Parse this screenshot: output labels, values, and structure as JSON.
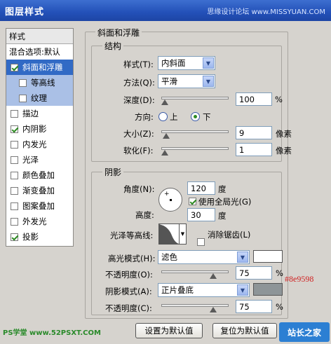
{
  "window": {
    "title": "图层样式",
    "watermark": "思缘设计论坛 www.MISSYUAN.COM"
  },
  "sidebar": {
    "head": "样式",
    "items": [
      {
        "label": "混合选项:默认"
      },
      {
        "label": "斜面和浮雕",
        "checked": true,
        "selected": true
      },
      {
        "label": "等高线",
        "checked": false
      },
      {
        "label": "纹理",
        "checked": false
      },
      {
        "label": "描边",
        "checked": false
      },
      {
        "label": "内阴影",
        "checked": true
      },
      {
        "label": "内发光",
        "checked": false
      },
      {
        "label": "光泽",
        "checked": false
      },
      {
        "label": "颜色叠加",
        "checked": false
      },
      {
        "label": "渐变叠加",
        "checked": false
      },
      {
        "label": "图案叠加",
        "checked": false
      },
      {
        "label": "外发光",
        "checked": false
      },
      {
        "label": "投影",
        "checked": true
      }
    ]
  },
  "bevel": {
    "title": "斜面和浮雕",
    "structure": {
      "title": "结构",
      "style_label": "样式(T):",
      "style_value": "内斜面",
      "technique_label": "方法(Q):",
      "technique_value": "平滑",
      "depth_label": "深度(D):",
      "depth_value": "100",
      "depth_unit": "%",
      "direction_label": "方向:",
      "direction_up": "上",
      "direction_down": "下",
      "size_label": "大小(Z):",
      "size_value": "9",
      "size_unit": "像素",
      "soften_label": "软化(F):",
      "soften_value": "1",
      "soften_unit": "像素"
    },
    "shading": {
      "title": "阴影",
      "angle_label": "角度(N):",
      "angle_value": "120",
      "angle_unit": "度",
      "global_light_label": "使用全局光(G)",
      "altitude_label": "高度:",
      "altitude_value": "30",
      "altitude_unit": "度",
      "gloss_label": "光泽等高线:",
      "antialias_label": "消除锯齿(L)",
      "highlight_mode_label": "高光模式(H):",
      "highlight_mode_value": "滤色",
      "highlight_opacity_label": "不透明度(O):",
      "highlight_opacity_value": "75",
      "highlight_opacity_unit": "%",
      "shadow_mode_label": "阴影模式(A):",
      "shadow_mode_value": "正片叠底",
      "shadow_color_hex": "#8e9598",
      "shadow_opacity_label": "不透明度(C):",
      "shadow_opacity_value": "75",
      "shadow_opacity_unit": "%"
    }
  },
  "buttons": {
    "set_default": "设置为默认值",
    "reset_default": "复位为默认值"
  },
  "footer": {
    "left_watermark": "PS学堂 www.52PSXT.COM",
    "right_watermark": "站长之家"
  },
  "colors": {
    "highlight": "#ffffff",
    "shadow": "#8e9598",
    "accent": "#316ac5"
  }
}
